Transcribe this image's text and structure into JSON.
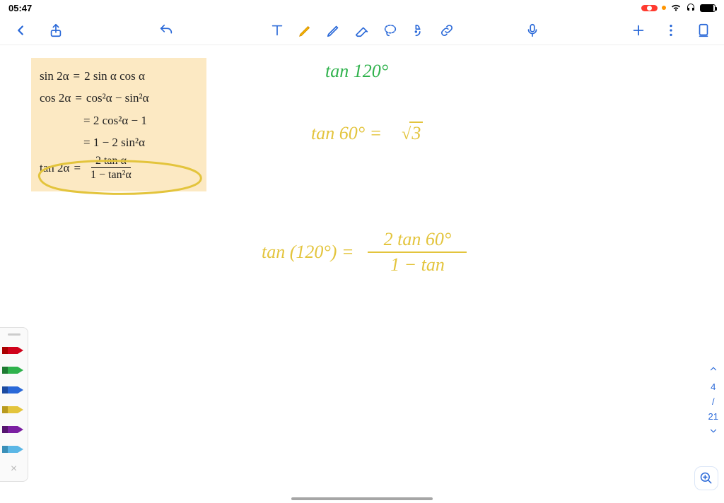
{
  "status": {
    "time": "05:47"
  },
  "formula_card": {
    "line1_lhs": "sin 2α",
    "line1_rhs": "2 sin α cos α",
    "line2_lhs": "cos 2α",
    "line2_rhs": "cos²α − sin²α",
    "line3": "= 2 cos²α − 1",
    "line4": "= 1 − 2 sin²α",
    "line5_lhs": "tan 2α",
    "line5_num": "2 tan α",
    "line5_den": "1 − tan²α"
  },
  "handwriting": {
    "problem": "tan 120°",
    "step1_lhs": "tan 60° =",
    "step1_rhs": "3",
    "step2_lhs": "tan (120°) =",
    "step2_num": "2 tan 60°",
    "step2_den": "1 − tan"
  },
  "page_nav": {
    "current": "4",
    "sep": "/",
    "total": "21"
  },
  "pen_colors": [
    "#d0021b",
    "#2fb24c",
    "#2968d8",
    "#e3c43c",
    "#7b1fa2",
    "#5bb7e6"
  ]
}
